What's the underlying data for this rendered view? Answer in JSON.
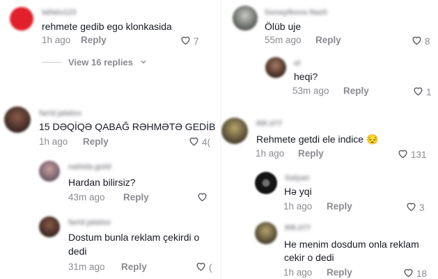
{
  "panel_top_left": {
    "comment": {
      "username": "lallalu123",
      "text": "rehmete gedib ego klonkasida",
      "time": "1h ago",
      "reply_label": "Reply",
      "likes": "7",
      "avatar_color": "#e0202a"
    },
    "view_replies_label": "View 16 replies"
  },
  "panel_bottom_left": {
    "comments": [
      {
        "username": "farid.jalalov",
        "text": "15 DƏQİQƏ QABAĞ RƏHMƏTƏ GEDİB",
        "time": "1h ago",
        "reply_label": "Reply",
        "likes": "4("
      },
      {
        "username": "nahida.gold",
        "text": "Hardan bilirsiz?",
        "time": "43m ago",
        "reply_label": "Reply",
        "likes": ""
      },
      {
        "username": "farid.jalalov",
        "text_line1": "Dostum bunla reklam çekirdi o",
        "text_line2": "dedi",
        "time": "31m ago",
        "reply_label": "Reply",
        "likes": "("
      }
    ]
  },
  "panel_right": {
    "comments": [
      {
        "username": "Sonaylkova Nazli",
        "text": "Ölüb uje",
        "time": "55m ago",
        "reply_label": "Reply",
        "likes": "8"
      },
      {
        "username": "el",
        "text": "heqi?",
        "time": "53m ago",
        "reply_label": "Reply",
        "likes": "1"
      },
      {
        "username": "RR.077",
        "text": "Rehmete getdi ele indice 😔",
        "time": "1h ago",
        "reply_label": "Reply",
        "likes": "131"
      },
      {
        "username": "Salyan",
        "text": "Hə yqi",
        "time": "1h ago",
        "reply_label": "Reply",
        "likes": "3"
      },
      {
        "username": "RR.077",
        "text_line1": "He menim dosdum onla reklam",
        "text_line2": "cekir o dedi",
        "time": "1h ago",
        "reply_label": "Reply",
        "likes": "18"
      }
    ]
  },
  "colors": {
    "secondary_text": "#8a8b91",
    "primary_text": "#161823"
  },
  "icons": {
    "like": "heart-outline-icon",
    "chevron": "chevron-down-icon"
  }
}
